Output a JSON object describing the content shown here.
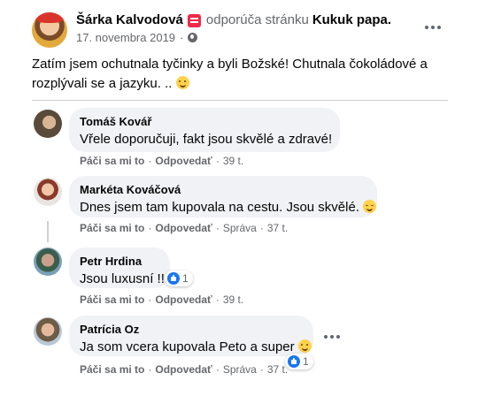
{
  "post": {
    "author": "Šárka Kalvodová",
    "recommends": "odporúča stránku",
    "page": "Kukuk papa.",
    "date": "17. novembra 2019",
    "separator": "·",
    "text": "Zatím jsem ochutnala tyčinky a byli Božské! Chutnala čokoládové a rozplývali se a jazyku. ..",
    "icons": {
      "privacy": "globe-icon",
      "badge": "recommend-badge-icon",
      "more": "more-options-icon"
    }
  },
  "comments": [
    {
      "name": "Tomáš Kovář",
      "text": "Vřele doporučuji, fakt jsou skvělé a zdravé!",
      "like": "Páči sa mi to",
      "reply": "Odpovedať",
      "edited": "",
      "time": "39 t.",
      "reactions": ""
    },
    {
      "name": "Markéta Kováčová",
      "text": "Dnes jsem tam kupovala na cestu. Jsou skvělé.",
      "like": "Páči sa mi to",
      "reply": "Odpovedať",
      "edited": "Správa",
      "time": "37 t.",
      "reactions": ""
    },
    {
      "name": "Petr Hrdina",
      "text": "Jsou luxusní !!",
      "like": "Páči sa mi to",
      "reply": "Odpovedať",
      "edited": "",
      "time": "39 t.",
      "reactions": "1"
    },
    {
      "name": "Patrícia Oz",
      "text": "Ja som vcera kupovala Peto a super",
      "like": "Páči sa mi to",
      "reply": "Odpovedať",
      "edited": "Správa",
      "time": "37 t.",
      "reactions": "1"
    }
  ],
  "colors": {
    "accent": "#1877f2",
    "bubble": "#f0f2f5",
    "muted": "#65676b",
    "badge": "#f02849"
  }
}
